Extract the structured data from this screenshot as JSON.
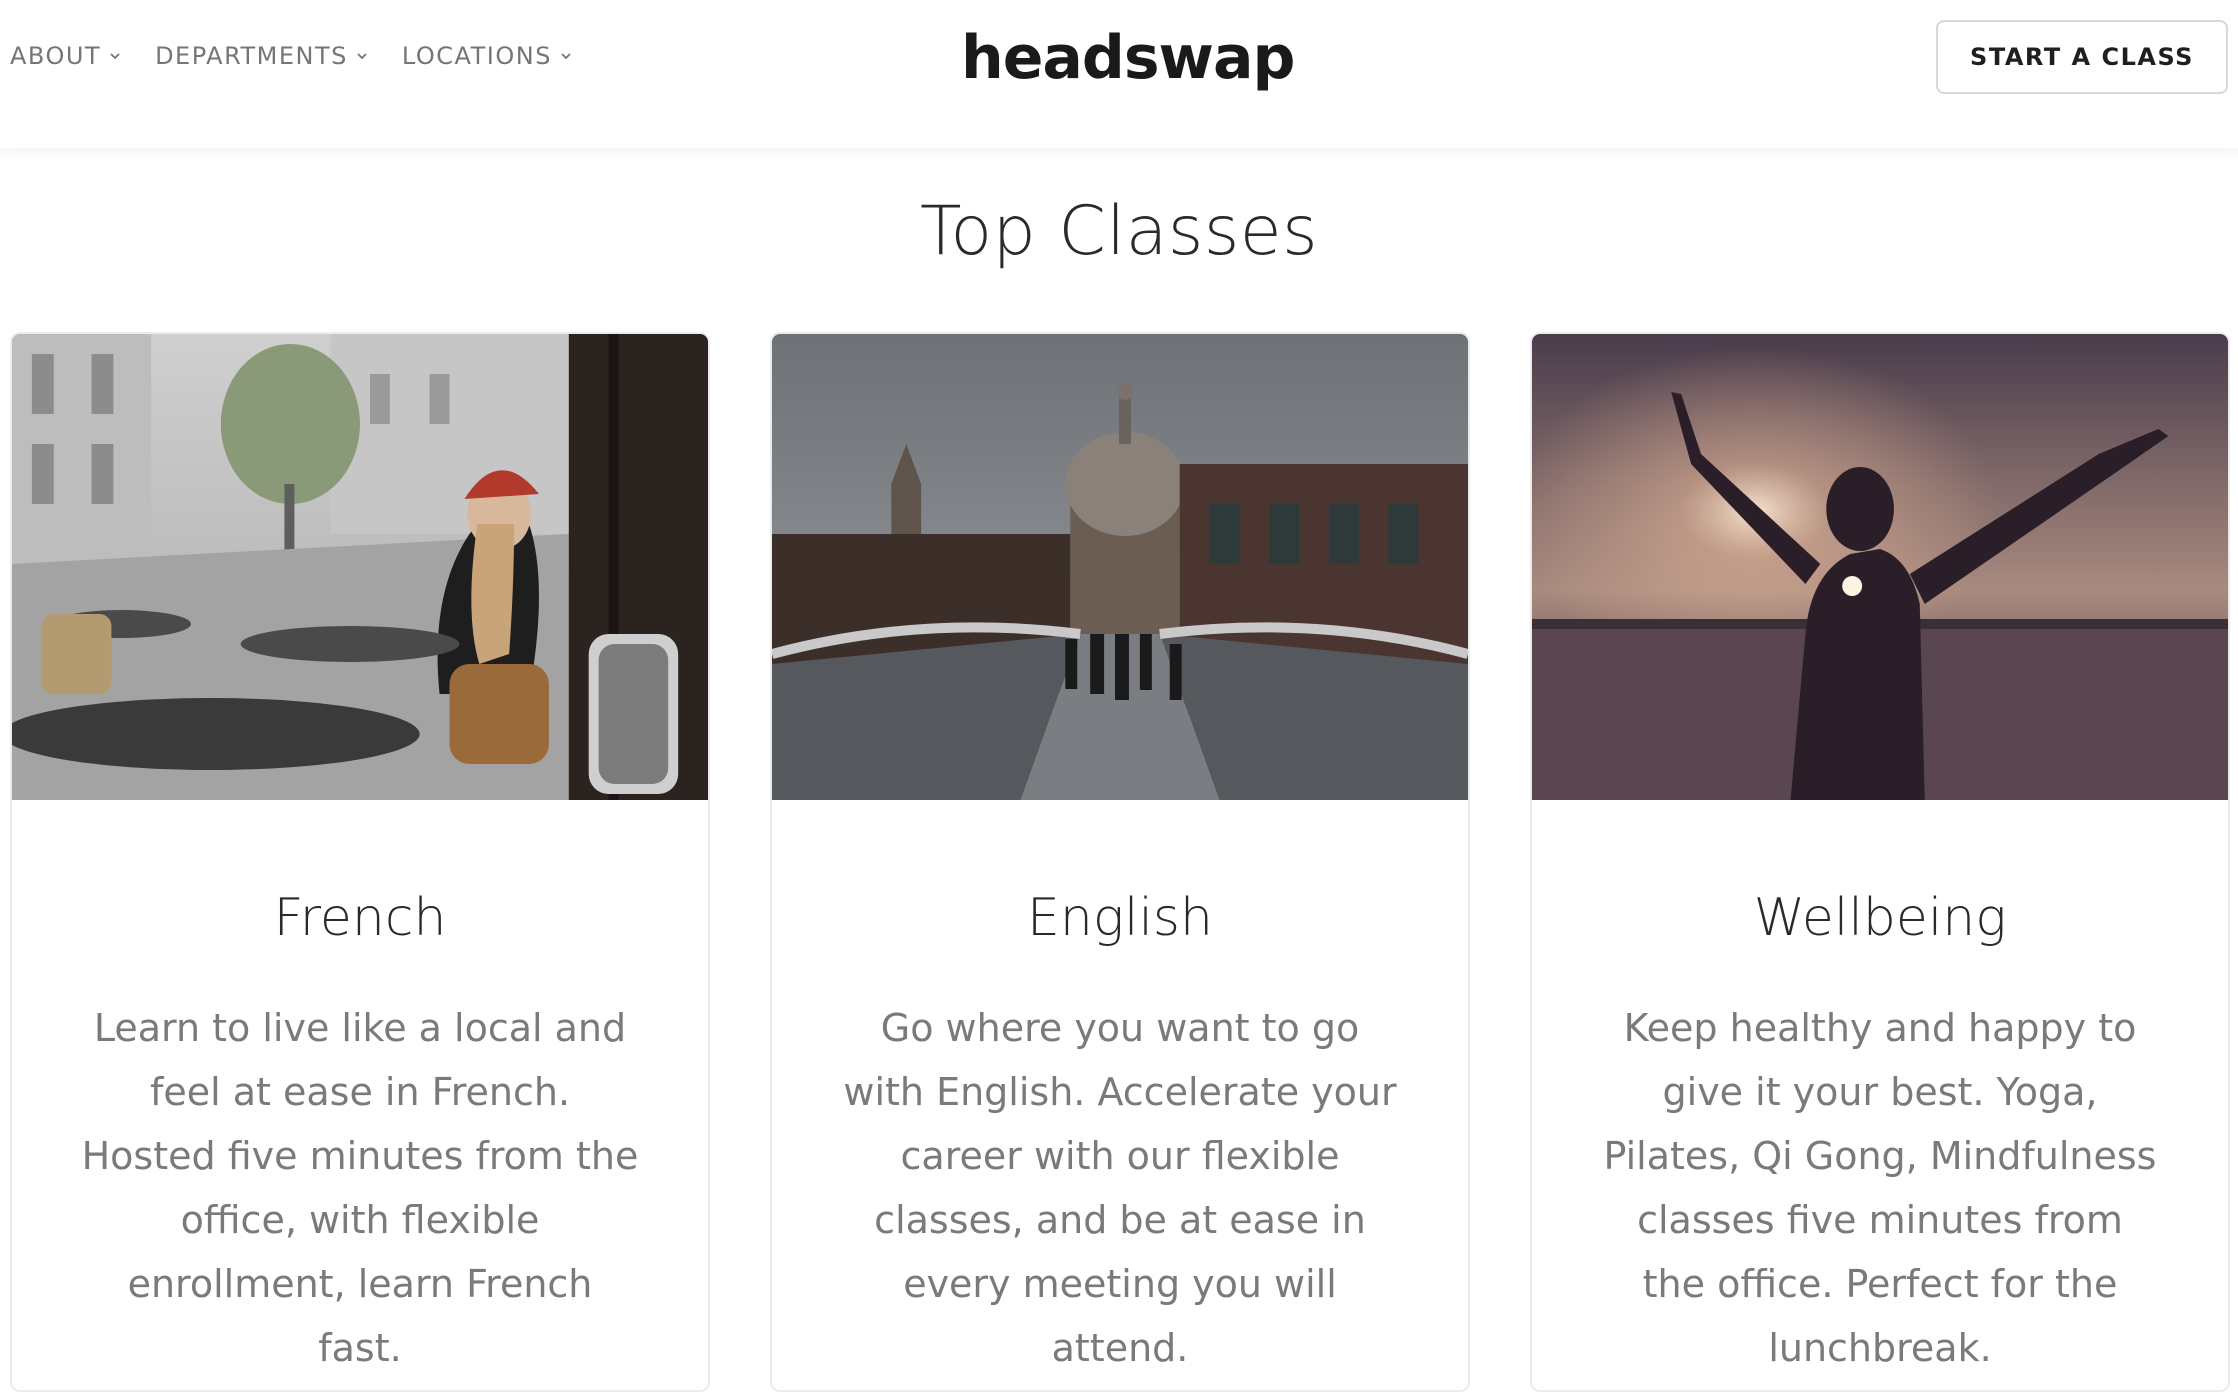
{
  "nav": {
    "items": [
      {
        "label": "ABOUT"
      },
      {
        "label": "DEPARTMENTS"
      },
      {
        "label": "LOCATIONS"
      }
    ]
  },
  "brand": {
    "logo": "headswap"
  },
  "header": {
    "cta_label": "START A CLASS"
  },
  "section": {
    "title": "Top Classes"
  },
  "cards": [
    {
      "title": "French",
      "description": "Learn to live like a local and feel at ease in French. Hosted five minutes from the office, with flexible enrollment, learn French fast.",
      "image": "paris-cafe-photo"
    },
    {
      "title": "English",
      "description": "Go where you want to go with English. Accelerate your career with our flexible classes, and be at ease in every meeting you will attend.",
      "image": "london-bridge-photo"
    },
    {
      "title": "Wellbeing",
      "description": "Keep healthy and happy to give it your best. Yoga, Pilates, Qi Gong, Mindfulness classes five minutes from the office. Perfect for the lunchbreak.",
      "image": "sunset-arms-raised-photo"
    }
  ],
  "colors": {
    "text_dark": "#2a2a2a",
    "text_muted": "#7a7a7a",
    "nav_text": "#757575",
    "border": "#ececec"
  }
}
